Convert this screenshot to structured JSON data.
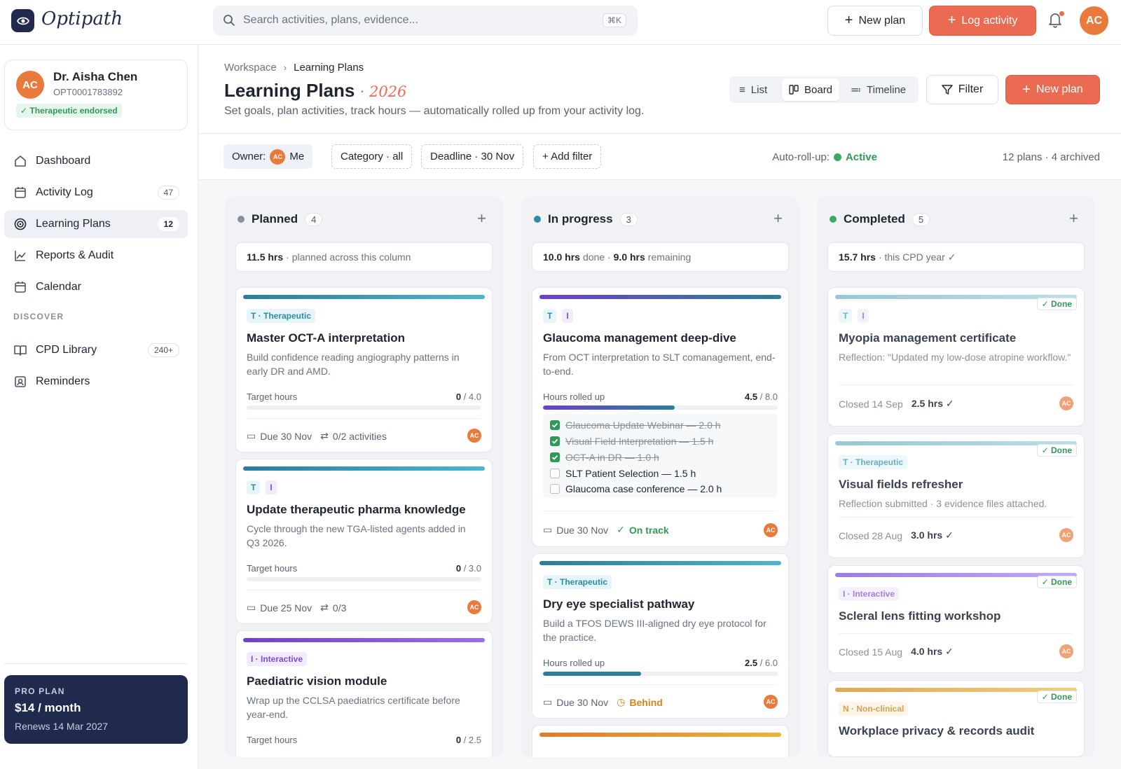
{
  "app": {
    "logo_text": "Optipath"
  },
  "search": {
    "placeholder": "Search activities, plans, evidence...",
    "shortcut": "⌘K"
  },
  "topbar": {
    "new_plan": "New plan",
    "log_activity": "Log activity",
    "avatar": "AC"
  },
  "profile": {
    "initials": "AC",
    "name": "Dr. Aisha Chen",
    "id": "OPT0001783892",
    "badge": "✓ Therapeutic endorsed"
  },
  "sidebar": {
    "items": [
      {
        "label": "Dashboard",
        "count": ""
      },
      {
        "label": "Activity Log",
        "count": "47"
      },
      {
        "label": "Learning Plans",
        "count": "12"
      },
      {
        "label": "Reports & Audit",
        "count": ""
      },
      {
        "label": "Calendar",
        "count": ""
      }
    ],
    "discover_label": "DISCOVER",
    "discover": [
      {
        "label": "CPD Library",
        "count": "240+"
      },
      {
        "label": "Reminders",
        "count": ""
      }
    ],
    "pro": {
      "kicker": "PRO PLAN",
      "price": "$14 / month",
      "renews": "Renews 14 Mar 2027"
    }
  },
  "header": {
    "crumb_root": "Workspace",
    "crumb_current": "Learning Plans",
    "title": "Learning Plans",
    "year": "· 2026",
    "subtitle": "Set goals, plan activities, track hours — automatically rolled up from your activity log.",
    "views": [
      "List",
      "Board",
      "Timeline"
    ],
    "filter": "Filter",
    "new_plan": "New plan"
  },
  "filters": {
    "owner_label": "Owner:",
    "owner_avatar": "AC",
    "owner_value": "Me",
    "category": "Category · all",
    "deadline": "Deadline · 30 Nov",
    "add": "+ Add filter",
    "autoroll_label": "Auto-roll-up:",
    "autoroll_value": "Active",
    "plans_count": "12 plans · 4 archived"
  },
  "columns": {
    "planned": {
      "name": "Planned",
      "count": "4",
      "color": "#8a909c",
      "summary_hrs": "11.5 hrs",
      "summary_text": "· planned across this column",
      "cards": [
        {
          "tags": [
            "T · Therapeutic"
          ],
          "title": "Master OCT-A interpretation",
          "desc": "Build confidence reading angiography patterns in early DR and AMD.",
          "hours_label": "Target hours",
          "done": "0",
          "target": "/ 4.0",
          "progress": 0.0,
          "due": "Due 30 Nov",
          "activities": "0/2 activities",
          "avatar": "AC"
        },
        {
          "tags": [
            "T",
            "I"
          ],
          "title": "Update therapeutic pharma knowledge",
          "desc": "Cycle through the new TGA-listed agents added in Q3 2026.",
          "hours_label": "Target hours",
          "done": "0",
          "target": "/ 3.0",
          "progress": 0.0,
          "due": "Due 25 Nov",
          "activities": "0/3",
          "avatar": "AC"
        },
        {
          "tags": [
            "I · Interactive"
          ],
          "title": "Paediatric vision module",
          "desc": "Wrap up the CCLSA paediatrics certificate before year-end.",
          "hours_label": "Target hours",
          "done": "0",
          "target": "/ 2.5",
          "progress": 0.0
        }
      ]
    },
    "inprogress": {
      "name": "In progress",
      "count": "3",
      "color": "#2b8ca3",
      "summary_done": "10.0 hrs",
      "summary_done_label": "done ·",
      "summary_rem": "9.0 hrs",
      "summary_rem_label": "remaining",
      "cards": [
        {
          "tags": [
            "T",
            "I"
          ],
          "title": "Glaucoma management deep-dive",
          "desc": "From OCT interpretation to SLT comanagement, end-to-end.",
          "hours_label": "Hours rolled up",
          "done": "4.5",
          "target": "/ 8.0",
          "progress": 0.5625,
          "checklist": [
            {
              "label": "Glaucoma Update Webinar — 2.0 h",
              "done": true
            },
            {
              "label": "Visual Field Interpretation — 1.5 h",
              "done": true
            },
            {
              "label": "OCT-A in DR — 1.0 h",
              "done": true
            },
            {
              "label": "SLT Patient Selection — 1.5 h",
              "done": false
            },
            {
              "label": "Glaucoma case conference — 2.0 h",
              "done": false
            }
          ],
          "due": "Due 30 Nov",
          "status": "On track",
          "avatar": "AC"
        },
        {
          "tags": [
            "T · Therapeutic"
          ],
          "title": "Dry eye specialist pathway",
          "desc": "Build a TFOS DEWS III-aligned dry eye protocol for the practice.",
          "hours_label": "Hours rolled up",
          "done": "2.5",
          "target": "/ 6.0",
          "progress": 0.4167,
          "due": "Due 30 Nov",
          "status": "Behind",
          "avatar": "AC"
        }
      ]
    },
    "completed": {
      "name": "Completed",
      "count": "5",
      "color": "#3aaa62",
      "summary_hrs": "15.7 hrs",
      "summary_text": "· this CPD year ✓",
      "done_label": "✓ Done",
      "cards": [
        {
          "tags": [
            "T",
            "I"
          ],
          "title": "Myopia management certificate",
          "desc": "Reflection: \"Updated my low-dose atropine workflow.\"",
          "closed": "Closed 14 Sep",
          "hrs": "2.5 hrs ✓",
          "avatar": "AC"
        },
        {
          "tags": [
            "T · Therapeutic"
          ],
          "title": "Visual fields refresher",
          "desc": "Reflection submitted · 3 evidence files attached.",
          "closed": "Closed 28 Aug",
          "hrs": "3.0 hrs ✓",
          "avatar": "AC"
        },
        {
          "tags": [
            "I · Interactive"
          ],
          "title": "Scleral lens fitting workshop",
          "closed": "Closed 15 Aug",
          "hrs": "4.0 hrs ✓",
          "avatar": "AC"
        },
        {
          "tags": [
            "N · Non-clinical"
          ],
          "title": "Workplace privacy & records audit"
        }
      ]
    }
  },
  "colors": {
    "accent": "#ea6a52",
    "navy": "#1f2a4d",
    "teal": "#2b8ca3",
    "purple": "#7c4ad8",
    "amber": "#e0a033",
    "green": "#2f9a58"
  }
}
